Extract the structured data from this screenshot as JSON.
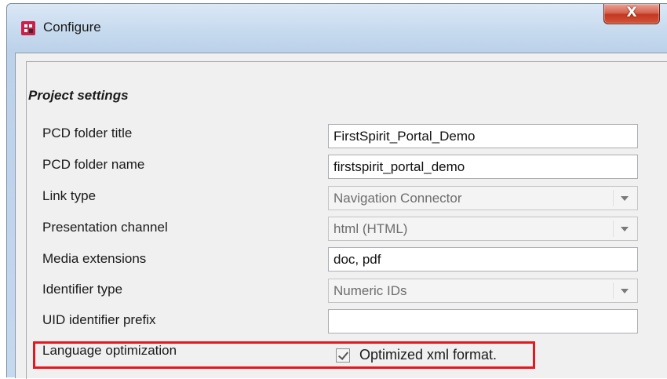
{
  "window": {
    "title": "Configure",
    "close_label": "X"
  },
  "section": {
    "title": "Project settings"
  },
  "fields": {
    "pcd_folder_title": {
      "label": "PCD folder title",
      "value": "FirstSpirit_Portal_Demo"
    },
    "pcd_folder_name": {
      "label": "PCD folder name",
      "value": "firstspirit_portal_demo"
    },
    "link_type": {
      "label": "Link type",
      "value": "Navigation Connector"
    },
    "presentation_channel": {
      "label": "Presentation channel",
      "value": "html (HTML)"
    },
    "media_extensions": {
      "label": "Media extensions",
      "value": "doc, pdf"
    },
    "identifier_type": {
      "label": "Identifier type",
      "value": "Numeric IDs"
    },
    "uid_identifier_prefix": {
      "label": "UID identifier prefix",
      "value": ""
    },
    "language_optimization": {
      "label": "Language optimization",
      "checkbox_label": "Optimized xml format.",
      "checked": true
    }
  },
  "colors": {
    "highlight": "#e5171f",
    "app_icon": "#c8214b",
    "close_button": "#c2381f"
  }
}
